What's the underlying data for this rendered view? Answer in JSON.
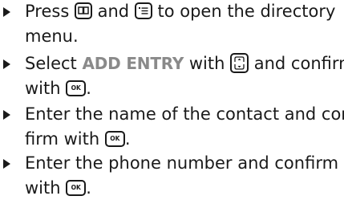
{
  "steps": [
    {
      "line1": {
        "a": "Press ",
        "b": " and ",
        "c": " to open the directory"
      },
      "line2": "menu."
    },
    {
      "line1": {
        "a": "Select ",
        "menu_term": "ADD ENTRY",
        "b": " with ",
        "c": " and confirm"
      },
      "line2": {
        "a": "with ",
        "b": "."
      }
    },
    {
      "line1": "Enter the name of the contact and con-",
      "line2": {
        "a": "firm with ",
        "b": "."
      }
    },
    {
      "line1": "Enter the phone number and confirm",
      "line2": {
        "a": "with ",
        "b": "."
      }
    }
  ],
  "keys": {
    "ok_label": "OK"
  },
  "icons": {
    "bullet": "triangle-bullet-icon",
    "directory_key": "directory-book-key-icon",
    "menu_key": "menu-list-key-icon",
    "navigation_key": "up-down-navigation-key-icon",
    "ok_key": "ok-key-icon"
  },
  "colors": {
    "text": "#1a1a1a",
    "menu_term": "#8a8a8a"
  }
}
